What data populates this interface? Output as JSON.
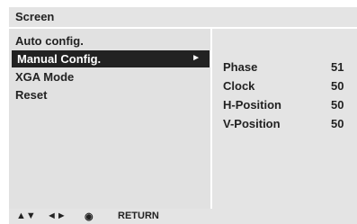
{
  "header": {
    "title": "Screen"
  },
  "menu": {
    "items": [
      {
        "label": "Auto config."
      },
      {
        "label": "Manual Config.",
        "arrow": "►"
      },
      {
        "label": "XGA Mode"
      },
      {
        "label": "Reset"
      }
    ]
  },
  "settings": {
    "rows": [
      {
        "name": "Phase",
        "value": "51"
      },
      {
        "name": "Clock",
        "value": "50"
      },
      {
        "name": "H-Position",
        "value": "50"
      },
      {
        "name": "V-Position",
        "value": "50"
      }
    ]
  },
  "footer": {
    "updown": "▲▼",
    "leftright": "◄►",
    "select": "◉",
    "return_label": "RETURN"
  },
  "colors": {
    "panel_bg": "#e4e4e4",
    "selected_bg": "#222222",
    "selected_fg": "#ffffff"
  }
}
